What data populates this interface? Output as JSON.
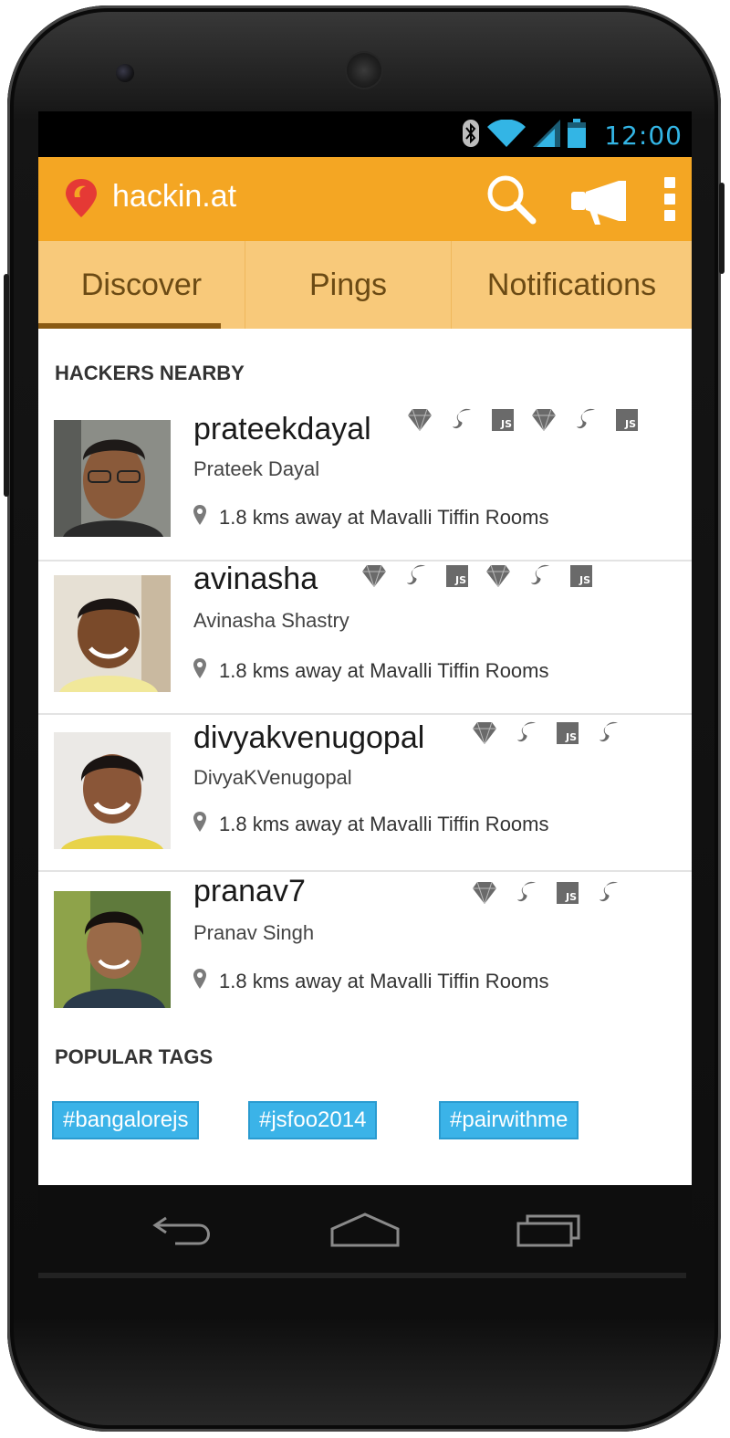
{
  "status_bar": {
    "time": "12:00",
    "icons": [
      "bluetooth-icon",
      "wifi-icon",
      "signal-icon",
      "battery-icon"
    ],
    "time_color": "#33b5e5"
  },
  "app_bar": {
    "title": "hackin.at",
    "logo_icon": "location-pin-logo-icon",
    "actions": [
      "search-icon",
      "megaphone-icon",
      "overflow-menu-icon"
    ],
    "color": "#f4a623"
  },
  "tabs": [
    {
      "label": "Discover",
      "active": true
    },
    {
      "label": "Pings",
      "active": false
    },
    {
      "label": "Notifications",
      "active": false
    }
  ],
  "hackers_nearby": {
    "heading": "HACKERS NEARBY",
    "items": [
      {
        "handle": "prateekdayal",
        "name": "Prateek Dayal",
        "location": "1.8 kms away at Mavalli Tiffin Rooms",
        "skills": [
          "ruby-icon",
          "sass-icon",
          "javascript-icon",
          "ruby-icon",
          "sass-icon",
          "javascript-icon"
        ]
      },
      {
        "handle": "avinasha",
        "name": "Avinasha Shastry",
        "location": "1.8 kms away at Mavalli Tiffin Rooms",
        "skills": [
          "ruby-icon",
          "sass-icon",
          "javascript-icon",
          "ruby-icon",
          "sass-icon",
          "javascript-icon"
        ]
      },
      {
        "handle": "divyakvenugopal",
        "name": "DivyaKVenugopal",
        "location": "1.8 kms away at Mavalli Tiffin Rooms",
        "skills": [
          "ruby-icon",
          "sass-icon",
          "javascript-icon",
          "sass-icon"
        ]
      },
      {
        "handle": "pranav7",
        "name": "Pranav Singh",
        "location": "1.8 kms away at Mavalli Tiffin Rooms",
        "skills": [
          "ruby-icon",
          "sass-icon",
          "javascript-icon",
          "sass-icon"
        ]
      }
    ]
  },
  "popular_tags": {
    "heading": "POPULAR TAGS",
    "tags": [
      "#bangalorejs",
      "#jsfoo2014",
      "#pairwithme"
    ],
    "tag_color": "#3bb3e8"
  },
  "nav_bar": {
    "buttons": [
      "back-icon",
      "home-icon",
      "recent-apps-icon"
    ]
  },
  "js_badge_text": "JS"
}
